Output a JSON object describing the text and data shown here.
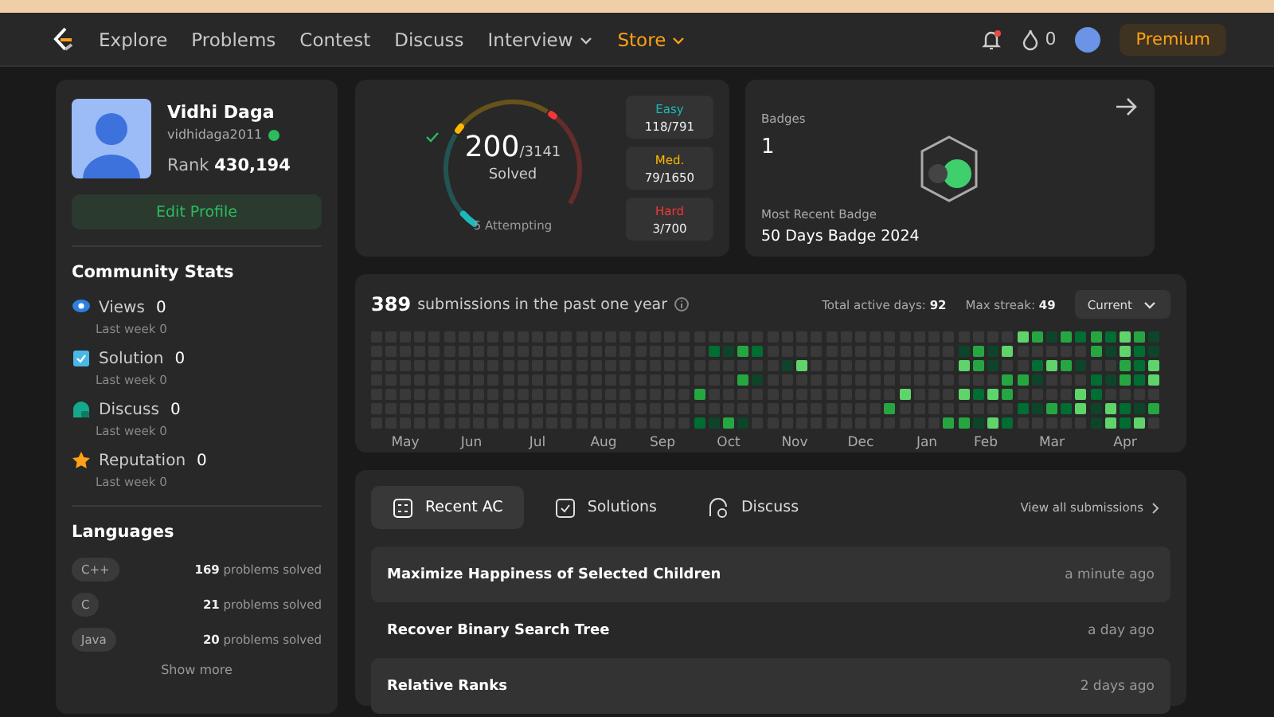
{
  "nav": {
    "items": [
      {
        "label": "Explore",
        "dropdown": false,
        "color": "#c8c8c8"
      },
      {
        "label": "Problems",
        "dropdown": false,
        "color": "#c8c8c8"
      },
      {
        "label": "Contest",
        "dropdown": false,
        "color": "#c8c8c8"
      },
      {
        "label": "Discuss",
        "dropdown": false,
        "color": "#c8c8c8"
      },
      {
        "label": "Interview",
        "dropdown": true,
        "color": "#c8c8c8"
      },
      {
        "label": "Store",
        "dropdown": true,
        "color": "#ffa116"
      }
    ],
    "streak": "0",
    "premium": "Premium"
  },
  "profile": {
    "name": "Vidhi Daga",
    "username": "vidhidaga2011",
    "rank_label": "Rank",
    "rank": "430,194",
    "edit_button": "Edit Profile"
  },
  "community_stats": {
    "title": "Community Stats",
    "items": [
      {
        "kind": "views",
        "label": "Views",
        "value": "0",
        "sub_label": "Last week",
        "sub_value": "0"
      },
      {
        "kind": "solution",
        "label": "Solution",
        "value": "0",
        "sub_label": "Last week",
        "sub_value": "0"
      },
      {
        "kind": "discuss",
        "label": "Discuss",
        "value": "0",
        "sub_label": "Last week",
        "sub_value": "0"
      },
      {
        "kind": "reputation",
        "label": "Reputation",
        "value": "0",
        "sub_label": "Last week",
        "sub_value": "0"
      }
    ]
  },
  "languages": {
    "title": "Languages",
    "items": [
      {
        "name": "C++",
        "count": "169",
        "suffix": "problems solved"
      },
      {
        "name": "C",
        "count": "21",
        "suffix": "problems solved"
      },
      {
        "name": "Java",
        "count": "20",
        "suffix": "problems solved"
      }
    ],
    "show_more": "Show more"
  },
  "solved": {
    "solved": "200",
    "total": "/3141",
    "label": "Solved",
    "attempting": "5 Attempting",
    "difficulties": [
      {
        "kind": "easy",
        "label": "Easy",
        "value": "118/791"
      },
      {
        "kind": "medium",
        "label": "Med.",
        "value": "79/1650"
      },
      {
        "kind": "hard",
        "label": "Hard",
        "value": "3/700"
      }
    ],
    "ring": [
      {
        "kind": "easy",
        "level": 0.149
      },
      {
        "kind": "medium",
        "level": 0.048
      },
      {
        "kind": "hard",
        "level": 0.004
      }
    ]
  },
  "badges": {
    "title": "Badges",
    "count": "1",
    "recent_label": "Most Recent Badge",
    "recent_name": "50 Days Badge 2024"
  },
  "submissions": {
    "count": "389",
    "text": "submissions in the past one year",
    "active_label": "Total active days:",
    "active": "92",
    "streak_label": "Max streak:",
    "streak": "49",
    "dropdown": "Current",
    "months": [
      "May",
      "Jun",
      "Jul",
      "Aug",
      "Sep",
      "Oct",
      "Nov",
      "Dec",
      "Jan",
      "Feb",
      "Mar",
      "Apr"
    ]
  },
  "recent": {
    "tabs": [
      {
        "kind": "recent",
        "label": "Recent AC",
        "selected": true
      },
      {
        "kind": "solutions",
        "label": "Solutions",
        "selected": false
      },
      {
        "kind": "discuss",
        "label": "Discuss",
        "selected": false
      }
    ],
    "view_all": "View all submissions",
    "rows": [
      {
        "title": "Maximize Happiness of Selected Children",
        "time": "a minute ago"
      },
      {
        "title": "Recover Binary Search Tree",
        "time": "a day ago"
      },
      {
        "title": "Relative Ranks",
        "time": "2 days ago"
      }
    ]
  }
}
